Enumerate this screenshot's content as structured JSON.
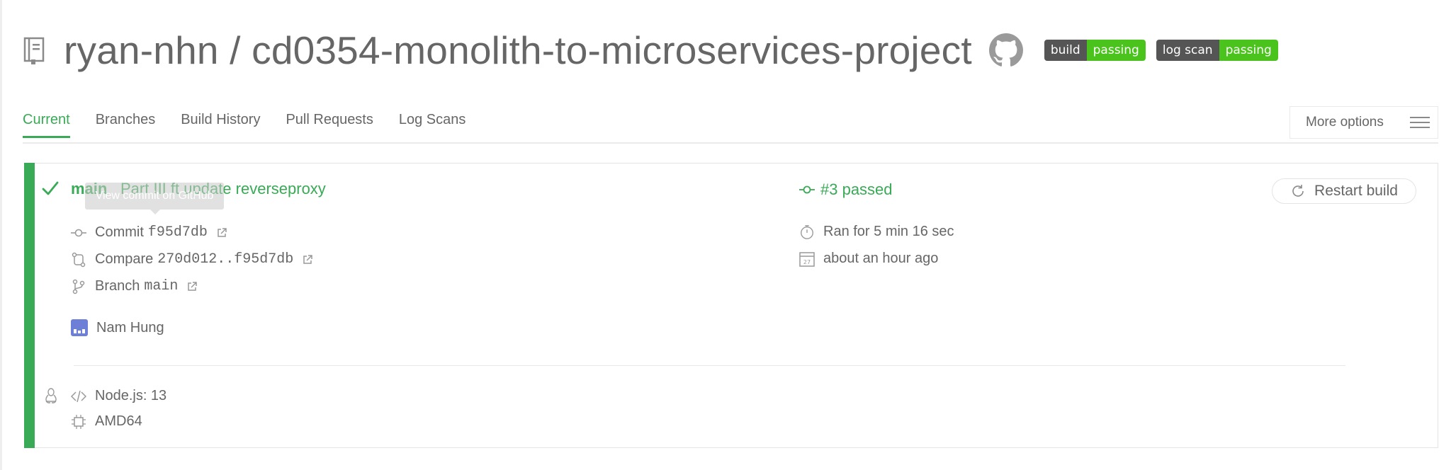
{
  "repo": {
    "owner": "ryan-nhn",
    "name": "cd0354-monolith-to-microservices-project",
    "title": "ryan-nhn / cd0354-monolith-to-microservices-project"
  },
  "badges": [
    {
      "label": "build",
      "status": "passing"
    },
    {
      "label": "log scan",
      "status": "passing"
    }
  ],
  "tabs": [
    {
      "label": "Current",
      "active": true
    },
    {
      "label": "Branches",
      "active": false
    },
    {
      "label": "Build History",
      "active": false
    },
    {
      "label": "Pull Requests",
      "active": false
    },
    {
      "label": "Log Scans",
      "active": false
    }
  ],
  "more_options": {
    "label": "More options"
  },
  "build": {
    "branch": "main",
    "message": "Part III ft update reverseproxy",
    "tooltip": "View commit on GitHub",
    "commit_label": "Commit",
    "commit_sha": "f95d7db",
    "compare_label": "Compare",
    "compare_range": "270d012..f95d7db",
    "branch_label": "Branch",
    "branch_value": "main",
    "author": "Nam Hung",
    "status": "#3 passed",
    "duration": "Ran for 5 min 16 sec",
    "finished": "about an hour ago",
    "calendar_day": "27",
    "restart_label": "Restart build",
    "language": "Node.js: 13",
    "arch": "AMD64"
  },
  "colors": {
    "passed": "#39aa56",
    "badge_dark": "#555555",
    "badge_green": "#4ac41c",
    "text": "#666666"
  }
}
